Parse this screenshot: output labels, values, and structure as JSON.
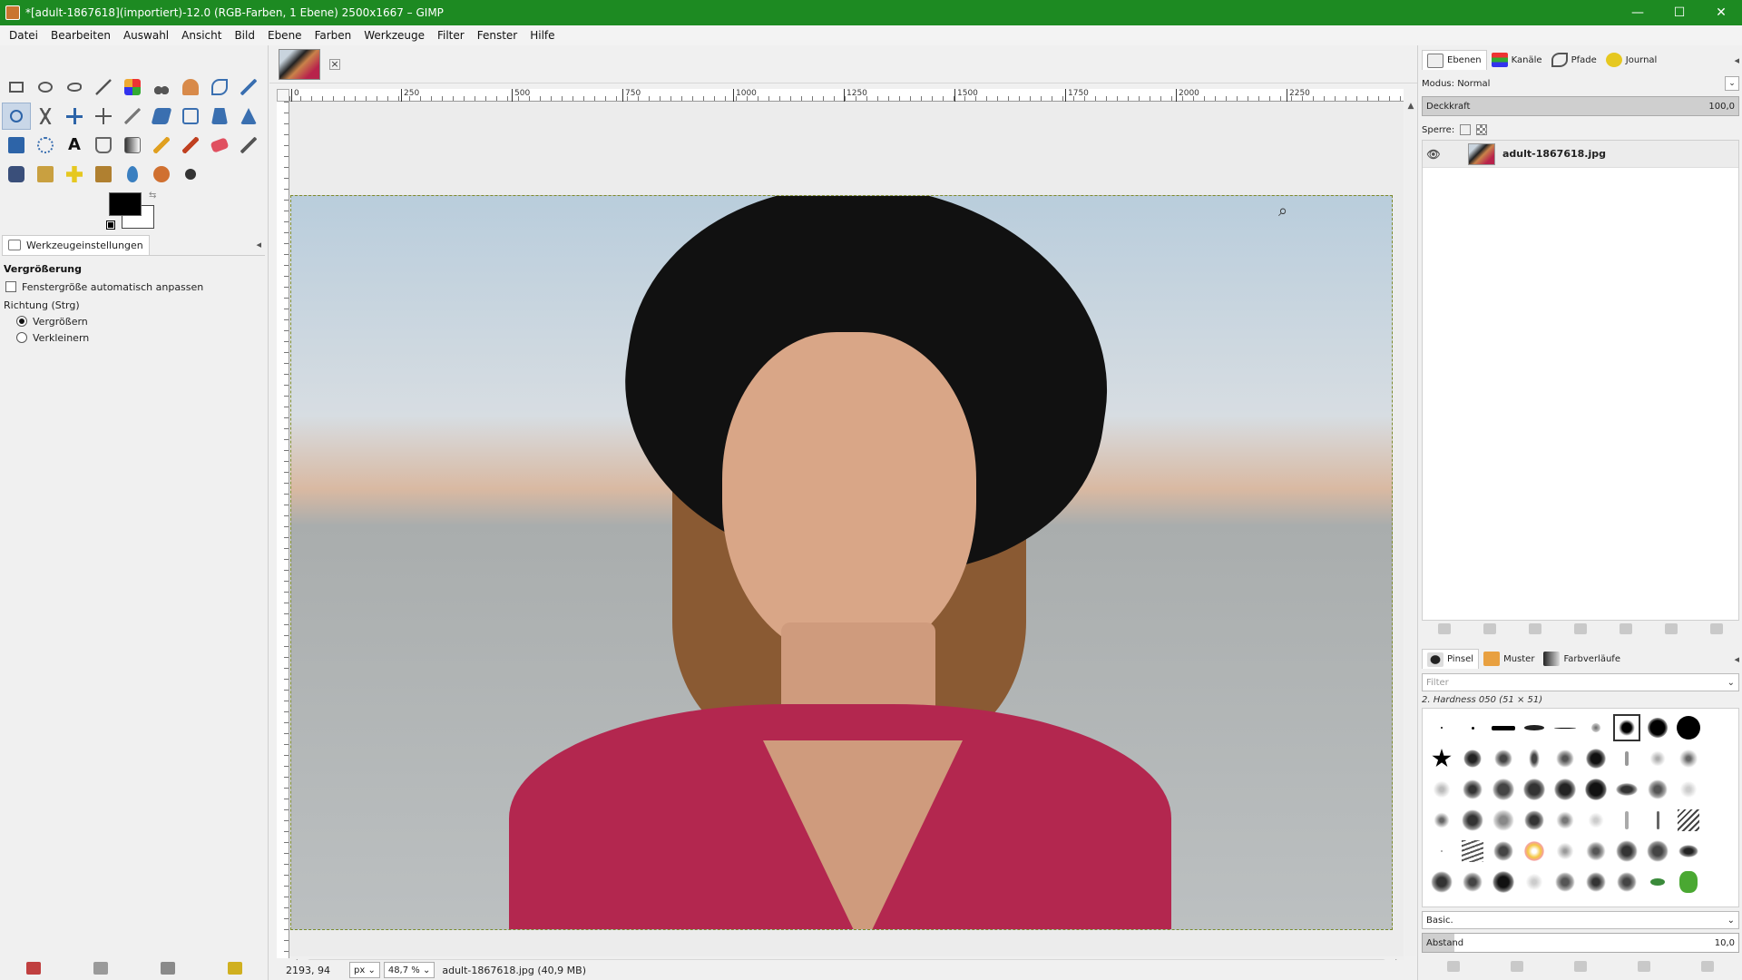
{
  "window": {
    "title": "*[adult-1867618](importiert)-12.0 (RGB-Farben, 1 Ebene) 2500x1667 – GIMP",
    "minimize": "—",
    "maximize": "☐",
    "close": "✕"
  },
  "menu": {
    "items": [
      "Datei",
      "Bearbeiten",
      "Auswahl",
      "Ansicht",
      "Bild",
      "Ebene",
      "Farben",
      "Werkzeuge",
      "Filter",
      "Fenster",
      "Hilfe"
    ]
  },
  "tool_options": {
    "tab_label": "Werkzeugeinstellungen",
    "title": "Vergrößerung",
    "auto_resize_label": "Fenstergröße automatisch anpassen",
    "direction_label": "Richtung (Strg)",
    "zoom_in_label": "Vergrößern",
    "zoom_out_label": "Verkleinern",
    "selected": "zoom_in"
  },
  "ruler": {
    "ticks": [
      "0",
      "250",
      "500",
      "750",
      "1000",
      "1250",
      "1500",
      "1750",
      "2000",
      "2250"
    ]
  },
  "status": {
    "coords": "2193, 94",
    "unit": "px",
    "zoom": "48,7 %",
    "file_info": "adult-1867618.jpg (40,9 MB)"
  },
  "layers_panel": {
    "tabs": [
      "Ebenen",
      "Kanäle",
      "Pfade",
      "Journal"
    ],
    "mode_label": "Modus: Normal",
    "opacity_label": "Deckkraft",
    "opacity_value": "100,0",
    "lock_label": "Sperre:",
    "layers": [
      {
        "name": "adult-1867618.jpg",
        "visible": true
      }
    ]
  },
  "brushes_panel": {
    "tabs": [
      "Pinsel",
      "Muster",
      "Farbverläufe"
    ],
    "filter_placeholder": "Filter",
    "brush_name": "2. Hardness 050 (51 × 51)",
    "preset": "Basic.",
    "spacing_label": "Abstand",
    "spacing_value": "10,0"
  },
  "colors": {
    "foreground": "#000000",
    "background": "#ffffff",
    "titlebar": "#1d8a22"
  }
}
